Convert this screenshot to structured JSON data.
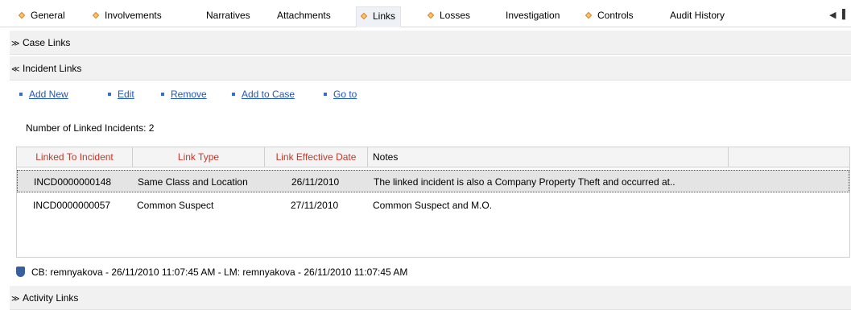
{
  "tabs": [
    {
      "label": "General",
      "diamond": true
    },
    {
      "label": "Involvements",
      "diamond": true
    },
    {
      "label": "Narratives",
      "diamond": false
    },
    {
      "label": "Attachments",
      "diamond": false
    },
    {
      "label": "Links",
      "diamond": true,
      "active": true
    },
    {
      "label": "Losses",
      "diamond": true
    },
    {
      "label": "Investigation",
      "diamond": false
    },
    {
      "label": "Controls",
      "diamond": true
    },
    {
      "label": "Audit History",
      "diamond": false
    }
  ],
  "scroll": {
    "left_glyph": "◀",
    "right_glyph": "▌"
  },
  "sections": {
    "case_links": {
      "title": "Case Links",
      "chevron": "¥"
    },
    "incident_links": {
      "title": "Incident Links",
      "chevron": "ʺ"
    },
    "activity_links": {
      "title": "Activity Links",
      "chevron": "¥"
    }
  },
  "actions": [
    "Add New",
    "Edit",
    "Remove",
    "Add to Case",
    "Go to"
  ],
  "count_text": "Number of Linked Incidents: 2",
  "grid": {
    "columns": [
      "Linked To Incident",
      "Link Type",
      "Link Effective Date",
      "Notes"
    ],
    "rows": [
      [
        "INCD0000000148",
        "Same Class and Location",
        "26/11/2010",
        "The linked incident is also a Company Property Theft and occurred at.."
      ],
      [
        "INCD0000000057",
        "Common Suspect",
        "27/11/2010",
        "Common Suspect and M.O."
      ]
    ],
    "selected_row": 0
  },
  "footer_text": "CB: remnyakova - 26/11/2010 11:07:45 AM - LM: remnyakova - 26/11/2010 11:07:45 AM",
  "colors": {
    "accent_link": "#1f56c2",
    "header_red": "#c0392b",
    "diamond": "#e0841c"
  }
}
